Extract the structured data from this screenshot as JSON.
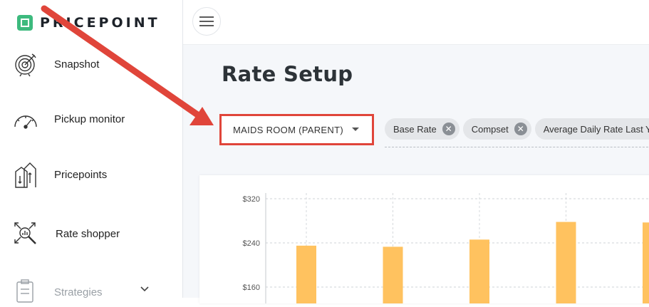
{
  "brand": {
    "name": "PRICEPOINT",
    "accent": "#3dba7e"
  },
  "sidebar": {
    "items": [
      {
        "label": "Snapshot",
        "icon": "target-icon"
      },
      {
        "label": "Pickup monitor",
        "icon": "gauge-icon"
      },
      {
        "label": "Pricepoints",
        "icon": "pricepoints-icon"
      },
      {
        "label": "Rate shopper",
        "icon": "rate-shopper-icon"
      },
      {
        "label": "Strategies",
        "icon": "strategies-icon"
      }
    ]
  },
  "page": {
    "title": "Rate Setup"
  },
  "room_select": {
    "value": "MAIDS ROOM (PARENT)"
  },
  "filters": [
    {
      "label": "Base Rate"
    },
    {
      "label": "Compset"
    },
    {
      "label": "Average Daily Rate Last Y"
    }
  ],
  "annotation": {
    "color": "#e0453a"
  },
  "chart_data": {
    "type": "bar",
    "y_tick_labels": [
      "$320",
      "$240",
      "$160"
    ],
    "ylim": [
      130,
      320
    ],
    "values": [
      235,
      233,
      246,
      278,
      277
    ],
    "bar_color": "#ffc25f",
    "grid": true
  }
}
